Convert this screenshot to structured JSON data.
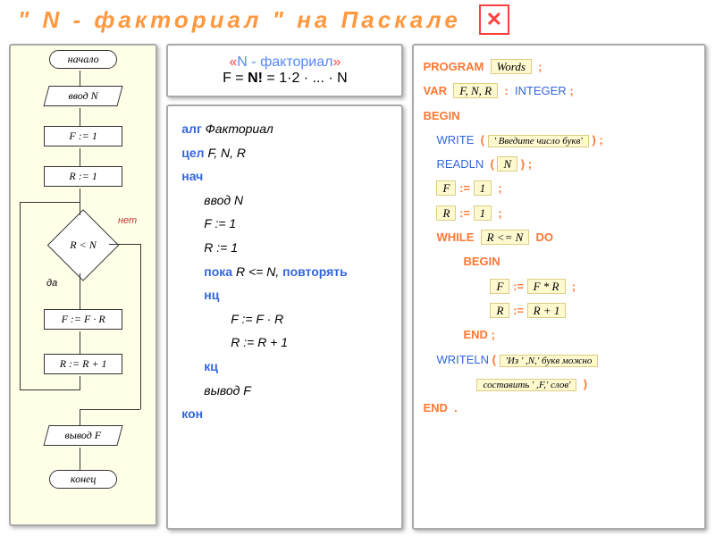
{
  "header": {
    "title": "\" N - факториал \"  на  Паскале"
  },
  "formula": {
    "line1_p1": "«",
    "line1_p2": "N - факториал",
    "line1_p3": "»",
    "line2_p1": "F = ",
    "line2_p2": "N!",
    "line2_p3": " = 1·2 · ... · N"
  },
  "flowchart": {
    "n1": "начало",
    "n2": "ввод N",
    "n3": "F := 1",
    "n4": "R := 1",
    "n5": "R < N",
    "n6": "F := F · R",
    "n7": "R := R + 1",
    "n8": "вывод F",
    "n9": "конец",
    "l_yes": "да",
    "l_no": "нет"
  },
  "algo": {
    "l1_k": "алг",
    "l1_t": " Факториал",
    "l2_k": "цел",
    "l2_t": " F, N, R",
    "l3_k": "нач",
    "l4": "ввод N",
    "l5": "F := 1",
    "l6": "R := 1",
    "l7_k": "пока",
    "l7_t": " R <= N, ",
    "l7_k2": "повторять",
    "l8_k": "нц",
    "l9": "F := F · R",
    "l10": "R := R + 1",
    "l11_k": "кц",
    "l12": "вывод F",
    "l13_k": "кон"
  },
  "code": {
    "k_program": "PROGRAM",
    "v_program": "Words",
    "k_var": "VAR",
    "v_var": "F, N, R",
    "k_int": "INTEGER",
    "k_begin": "BEGIN",
    "k_write": "WRITE",
    "v_write": "' Введите число букв'",
    "k_readln": "READLN",
    "v_readln": "N",
    "v_f": "F",
    "v_r": "R",
    "v_1": "1",
    "assign": ":=",
    "k_while": "WHILE",
    "v_while": "R <= N",
    "k_do": "DO",
    "v_fr": "F * R",
    "v_r1": "R + 1",
    "k_end": "END",
    "k_writeln": "WRITELN",
    "v_writeln1": "'Из ' ,N,' букв можно",
    "v_writeln2": "составить ' ,F,' слов'",
    "semi": ";",
    "colon": ":",
    "lpar": "(",
    "rpar": ")",
    "dot": "."
  }
}
